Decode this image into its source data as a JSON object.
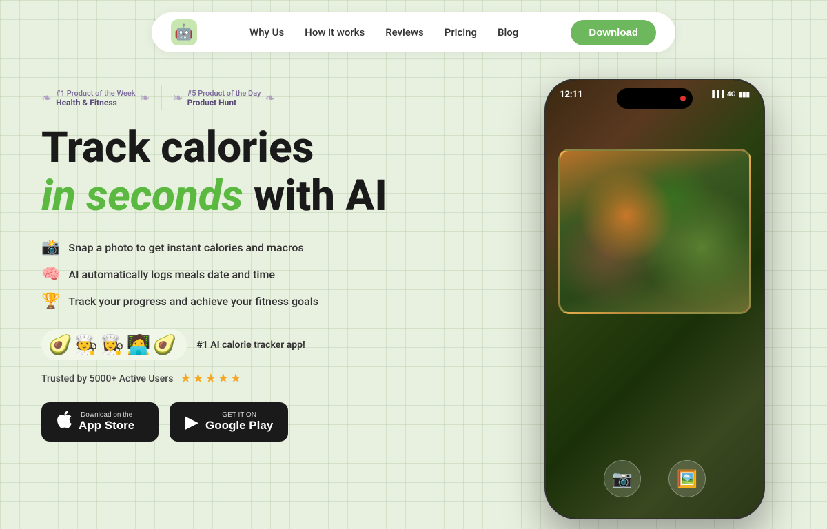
{
  "nav": {
    "logo_emoji": "🤖",
    "links": [
      {
        "label": "Why Us",
        "id": "why-us"
      },
      {
        "label": "How it works",
        "id": "how-it-works"
      },
      {
        "label": "Reviews",
        "id": "reviews"
      },
      {
        "label": "Pricing",
        "id": "pricing"
      },
      {
        "label": "Blog",
        "id": "blog"
      }
    ],
    "download_label": "Download"
  },
  "badges": [
    {
      "rank": "#1 Product of the Week",
      "category": "Health & Fitness"
    },
    {
      "rank": "#5 Product of the Day",
      "category": "Product Hunt"
    }
  ],
  "hero": {
    "line1": "Track calories",
    "line2_green": "in seconds",
    "line2_dark": " with AI"
  },
  "features": [
    {
      "emoji": "📸",
      "text": "Snap a photo to get instant calories and macros"
    },
    {
      "emoji": "🧠",
      "text": "AI automatically logs meals date and time"
    },
    {
      "emoji": "🏆",
      "text": "Track your progress and achieve your fitness goals"
    }
  ],
  "avatars": [
    "🥑",
    "🧑‍🍳",
    "👩‍🍳",
    "🧑‍💻",
    "🥑"
  ],
  "ai_badge": "#1 AI calorie tracker app!",
  "trusted": {
    "text": "Trusted by 5000+ Active Users",
    "stars": "★★★★★"
  },
  "store_buttons": [
    {
      "id": "app-store",
      "icon": "",
      "small": "Download on the",
      "large": "App Store"
    },
    {
      "id": "google-play",
      "icon": "▶",
      "small": "GET IT ON",
      "large": "Google Play"
    }
  ],
  "phone": {
    "time": "12:11",
    "network": "4G"
  }
}
